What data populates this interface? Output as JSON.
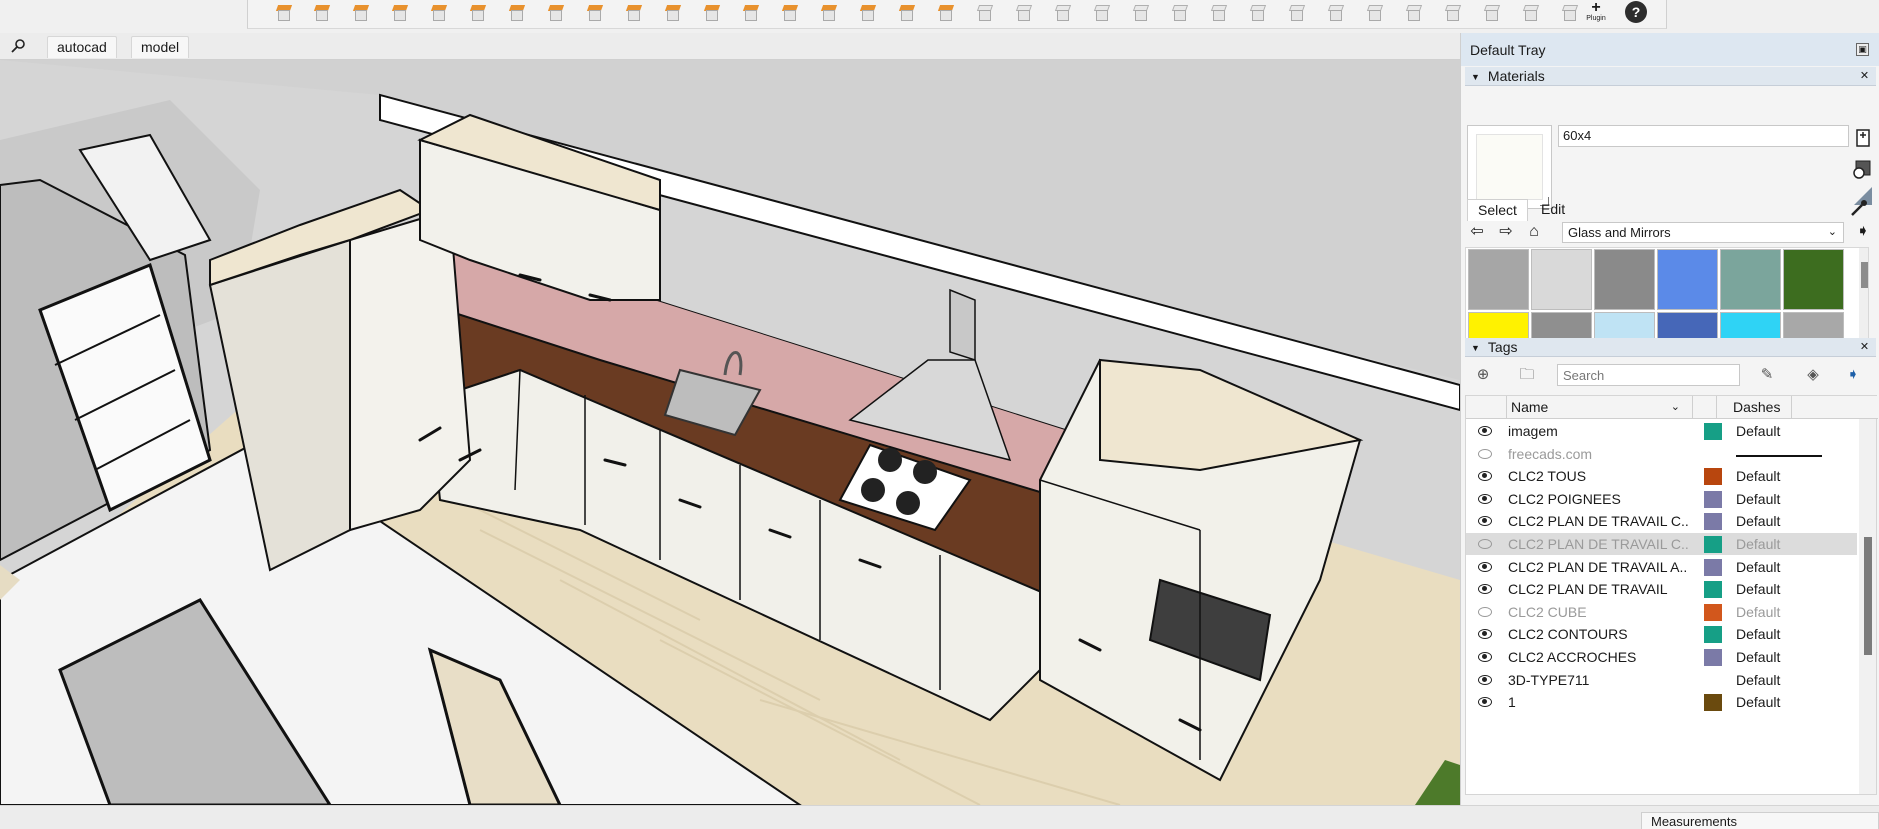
{
  "toolbar": {
    "plugin_label": "Plugin",
    "help_symbol": "?"
  },
  "scene_tabs": [
    "autocad",
    "model"
  ],
  "tray": {
    "title": "Default Tray",
    "materials": {
      "header": "Materials",
      "current_name": "60x4",
      "tab_select": "Select",
      "tab_edit": "Edit",
      "library": "Glass and Mirrors",
      "swatches": [
        "#a6a6a6",
        "#d9d9d9",
        "#8a8a8a",
        "#5b8ae8",
        "#7ba59c",
        "#3d6d1f",
        "#fff200",
        "#8f8f8f",
        "#bfe3f4",
        "#4667b8",
        "#2fd3f5",
        "#a8a8a8"
      ]
    },
    "tags": {
      "header": "Tags",
      "search_placeholder": "Search",
      "col_name": "Name",
      "col_dashes": "Dashes",
      "rows": [
        {
          "name": "imagem",
          "visible": true,
          "color": "#169f86",
          "dashes": "Default"
        },
        {
          "name": "freecads.com",
          "visible": false,
          "color": "",
          "dashes": ""
        },
        {
          "name": "CLC2 TOUS",
          "visible": true,
          "color": "#b8460e",
          "dashes": "Default"
        },
        {
          "name": "CLC2 POIGNEES",
          "visible": true,
          "color": "#7b7aa7",
          "dashes": "Default"
        },
        {
          "name": "CLC2 PLAN DE TRAVAIL C...",
          "visible": true,
          "color": "#7b7aa7",
          "dashes": "Default"
        },
        {
          "name": "CLC2 PLAN DE TRAVAIL C...",
          "visible": false,
          "color": "#169f86",
          "dashes": "Default"
        },
        {
          "name": "CLC2 PLAN DE TRAVAIL A...",
          "visible": true,
          "color": "#7b7aa7",
          "dashes": "Default"
        },
        {
          "name": "CLC2 PLAN DE TRAVAIL",
          "visible": true,
          "color": "#169f86",
          "dashes": "Default"
        },
        {
          "name": "CLC2 CUBE",
          "visible": false,
          "color": "#d2571c",
          "dashes": "Default"
        },
        {
          "name": "CLC2 CONTOURS",
          "visible": true,
          "color": "#169f86",
          "dashes": "Default"
        },
        {
          "name": "CLC2 ACCROCHES",
          "visible": true,
          "color": "#7b7aa7",
          "dashes": "Default"
        },
        {
          "name": "3D-TYPE711",
          "visible": true,
          "color": "",
          "dashes": "Default"
        },
        {
          "name": "1",
          "visible": true,
          "color": "#6a4a0e",
          "dashes": "Default"
        }
      ]
    }
  },
  "status": {
    "measurements_label": "Measurements"
  }
}
